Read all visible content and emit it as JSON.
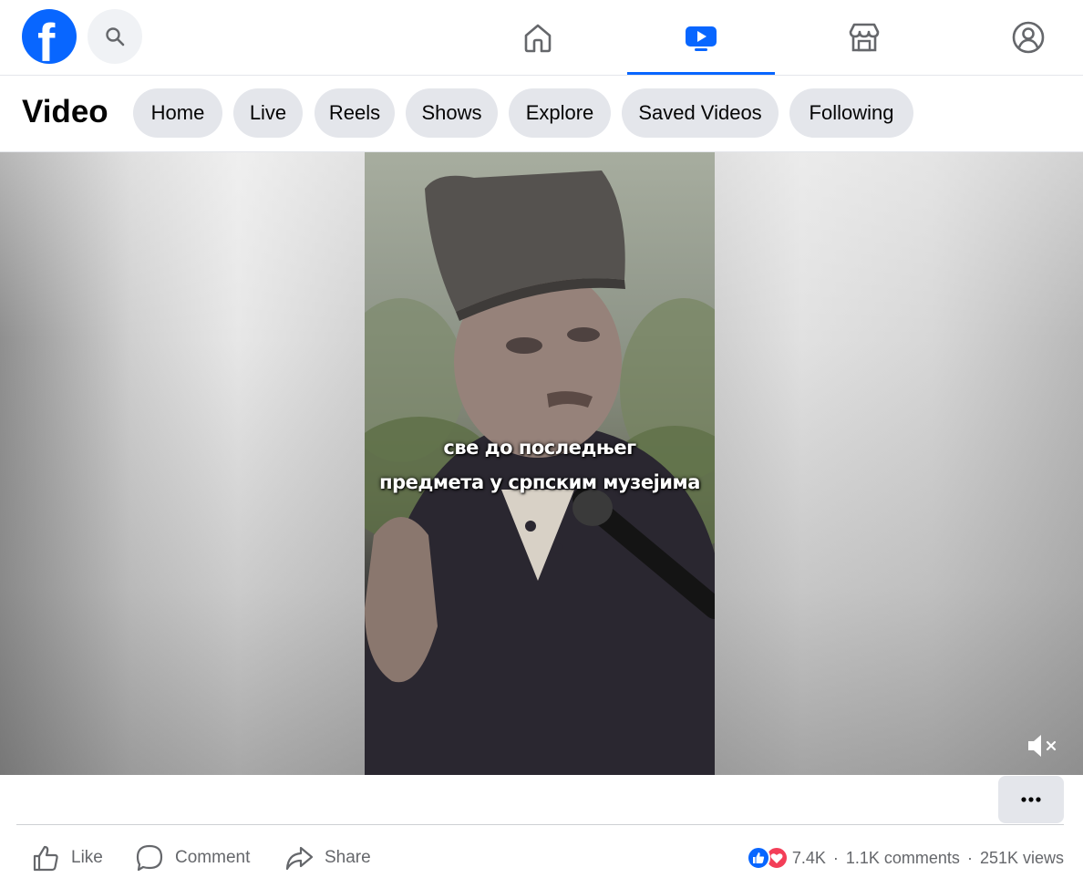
{
  "topbar": {
    "logo_letter": "f",
    "nav": [
      {
        "name": "home",
        "icon": "home-icon",
        "active": false
      },
      {
        "name": "video",
        "icon": "video-icon",
        "active": true
      },
      {
        "name": "marketplace",
        "icon": "marketplace-icon",
        "active": false
      },
      {
        "name": "profile",
        "icon": "profile-icon",
        "active": false
      }
    ]
  },
  "video_header": {
    "title": "Video",
    "chips": [
      "Home",
      "Live",
      "Reels",
      "Shows",
      "Explore",
      "Saved Videos",
      "Following"
    ]
  },
  "video": {
    "caption_lines": [
      "све до последњег",
      "предмета у српским музејима"
    ],
    "muted": true
  },
  "actions": {
    "like": "Like",
    "comment": "Comment",
    "share": "Share"
  },
  "stats": {
    "reactions": "7.4K",
    "comments": "1.1K comments",
    "views": "251K views",
    "separator": "·"
  },
  "colors": {
    "brand": "#0866ff",
    "chip_bg": "#e4e6eb",
    "love": "#f33e58"
  }
}
